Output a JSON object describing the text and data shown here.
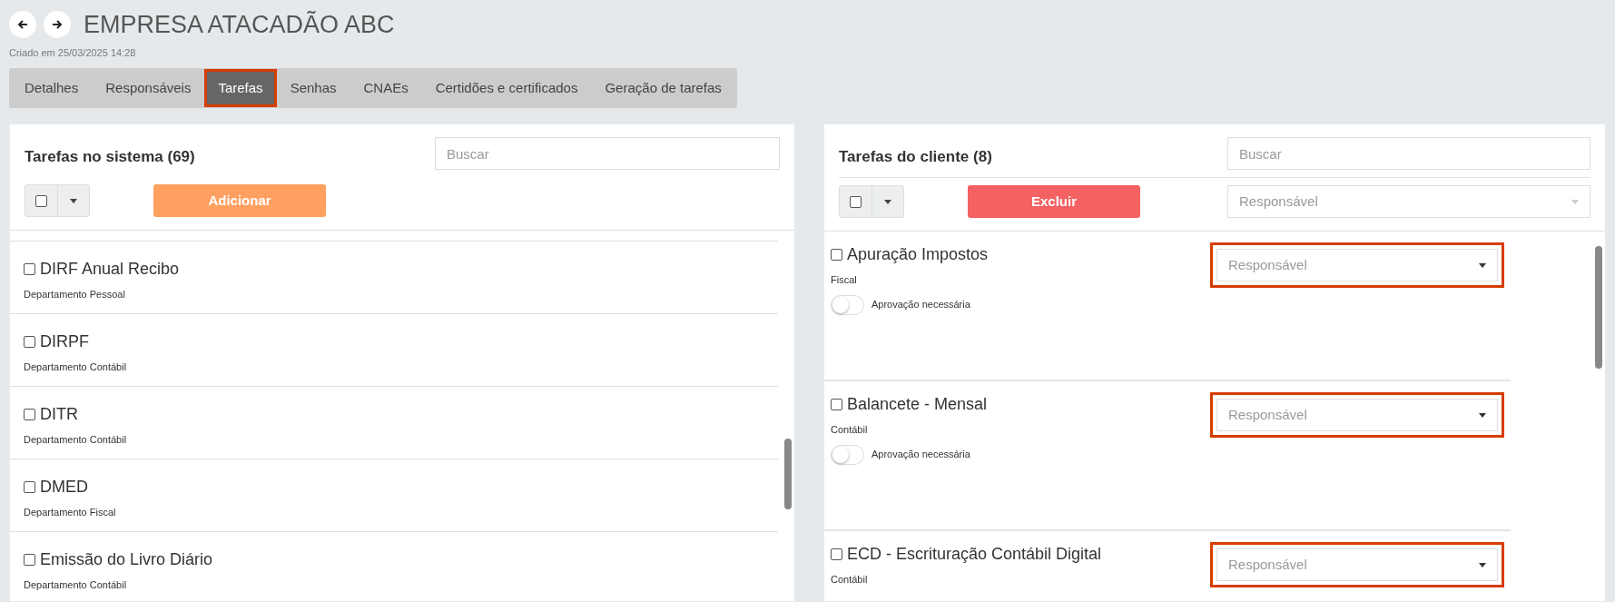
{
  "header": {
    "title": "EMPRESA ATACADÃO ABC",
    "created": "Criado em 25/03/2025 14:28"
  },
  "tabs": [
    {
      "label": "Detalhes",
      "selected": false,
      "highlighted": false
    },
    {
      "label": "Responsáveis",
      "selected": false,
      "highlighted": false
    },
    {
      "label": "Tarefas",
      "selected": true,
      "highlighted": true
    },
    {
      "label": "Senhas",
      "selected": false,
      "highlighted": false
    },
    {
      "label": "CNAEs",
      "selected": false,
      "highlighted": false
    },
    {
      "label": "Certidões e certificados",
      "selected": false,
      "highlighted": false
    },
    {
      "label": "Geração de tarefas",
      "selected": false,
      "highlighted": false
    }
  ],
  "system_panel": {
    "title": "Tarefas no sistema (69)",
    "search": {
      "placeholder": "Buscar"
    },
    "select_all": {
      "checked": false
    },
    "action": {
      "label": "Adicionar",
      "kind": "add"
    },
    "tasks": [
      {
        "name": "DIRF Anual Recibo",
        "department": "Departamento Pessoal",
        "checked": false
      },
      {
        "name": "DIRPF",
        "department": "Departamento Contábil",
        "checked": false
      },
      {
        "name": "DITR",
        "department": "Departamento Contábil",
        "checked": false
      },
      {
        "name": "DMED",
        "department": "Departamento Fiscal",
        "checked": false
      },
      {
        "name": "Emissão do Livro Diário",
        "department": "Departamento Contábil",
        "checked": false
      }
    ]
  },
  "client_panel": {
    "title": "Tarefas do cliente (8)",
    "search": {
      "placeholder": "Buscar"
    },
    "select_all": {
      "checked": false
    },
    "action": {
      "label": "Excluir",
      "kind": "delete"
    },
    "filter": {
      "placeholder": "Responsável"
    },
    "tasks": [
      {
        "name": "Apuração Impostos",
        "department": "Fiscal",
        "checked": false,
        "responsible": {
          "placeholder": "Responsável",
          "highlighted": true
        },
        "approval": {
          "label": "Aprovação necessária",
          "on": false
        }
      },
      {
        "name": "Balancete - Mensal",
        "department": "Contábil",
        "checked": false,
        "responsible": {
          "placeholder": "Responsável",
          "highlighted": true
        },
        "approval": {
          "label": "Aprovação necessária",
          "on": false
        }
      },
      {
        "name": "ECD - Escrituração Contábil Digital",
        "department": "Contábil",
        "checked": false,
        "responsible": {
          "placeholder": "Responsável",
          "highlighted": true
        }
      }
    ]
  }
}
